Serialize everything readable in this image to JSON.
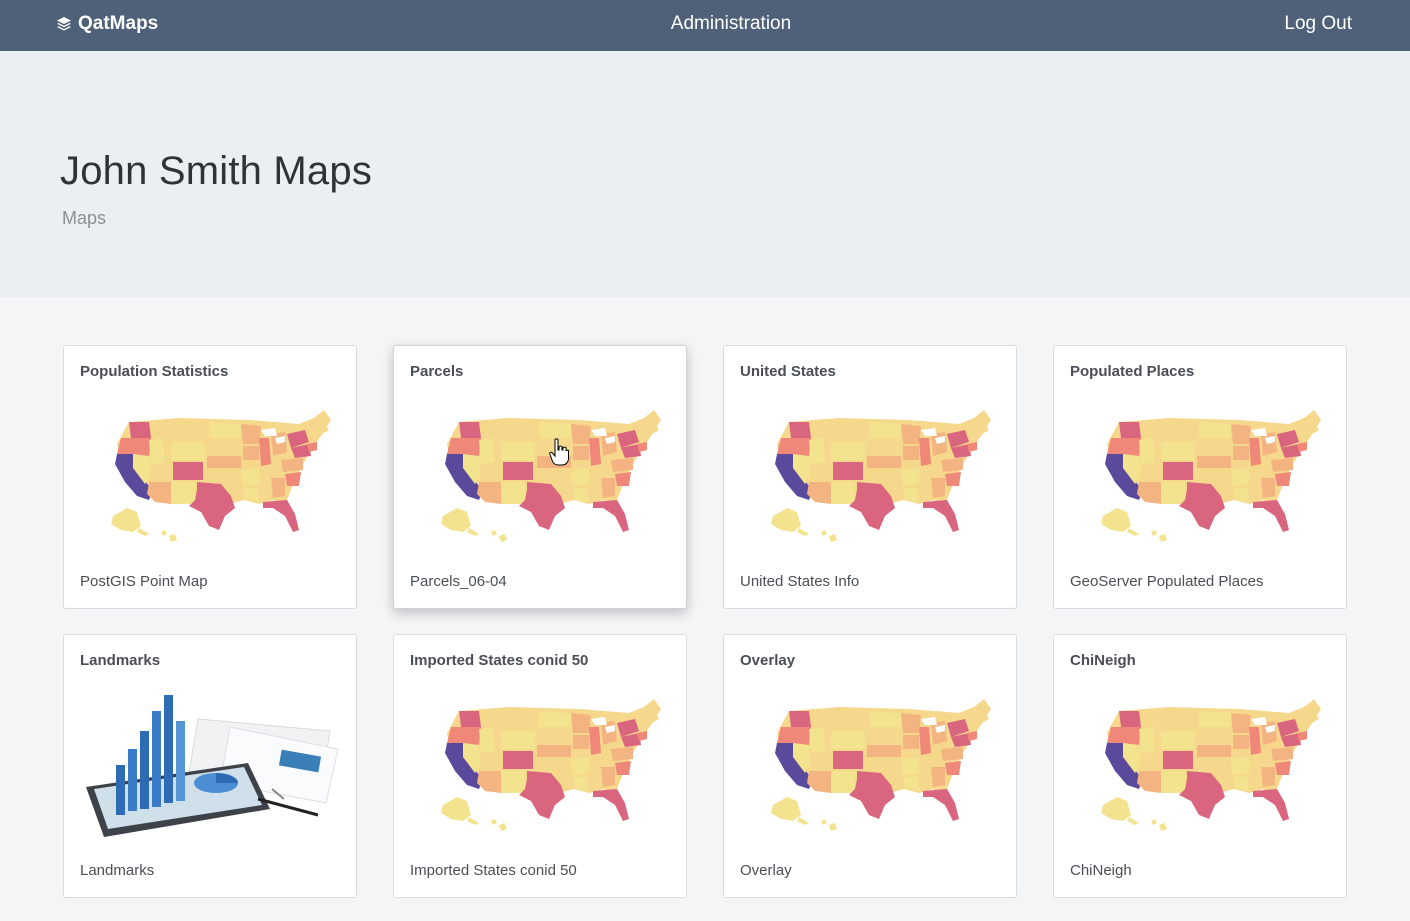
{
  "navbar": {
    "brand": "QatMaps",
    "brand_icon": "layers-icon",
    "admin_label": "Administration",
    "logout_label": "Log Out",
    "background": "#4e6178"
  },
  "hero": {
    "title": "John Smith Maps",
    "subtitle": "Maps"
  },
  "cards": [
    {
      "title": "Population Statistics",
      "footer": "PostGIS Point Map",
      "thumbnail": "us-map"
    },
    {
      "title": "Parcels",
      "footer": "Parcels_06-04",
      "thumbnail": "us-map"
    },
    {
      "title": "United States",
      "footer": "United States Info",
      "thumbnail": "us-map"
    },
    {
      "title": "Populated Places",
      "footer": "GeoServer Populated Places",
      "thumbnail": "us-map"
    },
    {
      "title": "Landmarks",
      "footer": "Landmarks",
      "thumbnail": "tablet-chart-photo"
    },
    {
      "title": "Imported States conid 50",
      "footer": "Imported States conid 50",
      "thumbnail": "us-map"
    },
    {
      "title": "Overlay",
      "footer": "Overlay",
      "thumbnail": "us-map"
    },
    {
      "title": "ChiNeigh",
      "footer": "ChiNeigh",
      "thumbnail": "us-map"
    }
  ],
  "map_palette": {
    "west_coast": "#5b4a9c",
    "pink": "#d9667e",
    "orange": "#ef8878",
    "tan": "#f4b482",
    "light": "#f6d88c",
    "pale": "#f3e38f"
  }
}
